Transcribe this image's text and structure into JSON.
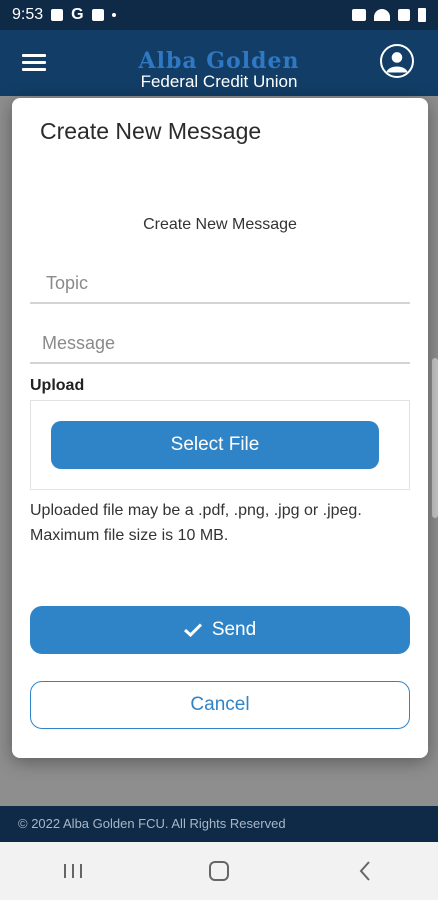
{
  "status_bar": {
    "time": "9:53",
    "g_label": "G"
  },
  "header": {
    "brand_line1": "Alba Golden",
    "brand_line2": "Federal Credit Union"
  },
  "modal": {
    "title": "Create New Message",
    "subtitle": "Create New Message",
    "topic_placeholder": "Topic",
    "message_placeholder": "Message",
    "upload_label": "Upload",
    "select_file_label": "Select File",
    "note_line1": "Uploaded file may be a .pdf, .png, .jpg or .jpeg.",
    "note_line2": "Maximum file size is 10 MB.",
    "send_label": "Send",
    "cancel_label": "Cancel"
  },
  "footer": {
    "copyright": "© 2022 Alba Golden FCU. All Rights Reserved"
  },
  "colors": {
    "primary": "#2f84c8",
    "header_bg": "#123d66",
    "footer_bg": "#0f2a47"
  },
  "icons": [
    "menu-icon",
    "profile-icon",
    "check-icon",
    "recents-icon",
    "home-icon",
    "back-icon"
  ]
}
